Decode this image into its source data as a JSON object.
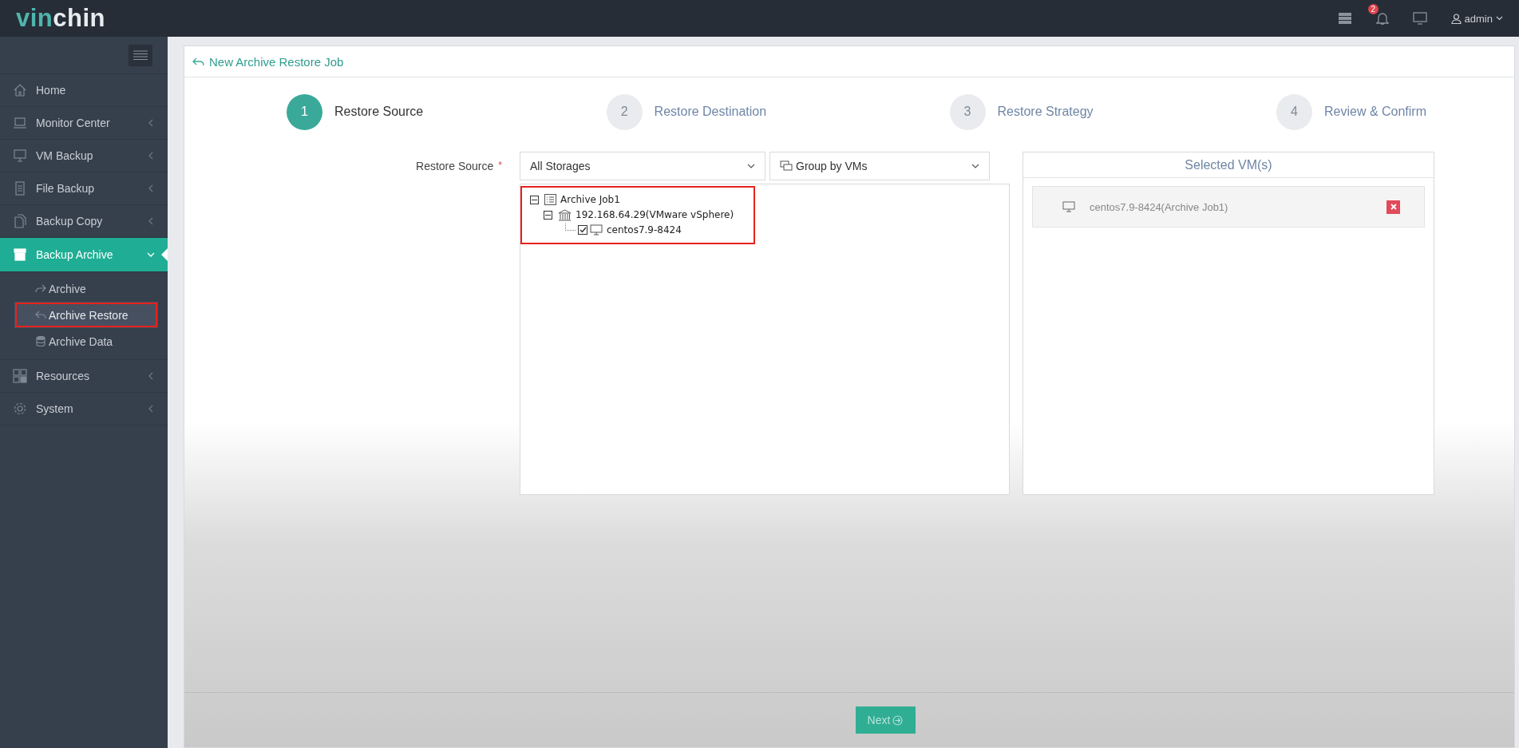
{
  "topbar": {
    "logo": [
      "vin",
      "chin"
    ],
    "notifications": "2",
    "user": "admin"
  },
  "sidebar": {
    "items": [
      {
        "label": "Home",
        "kind": "home",
        "selected": false,
        "expandable": false
      },
      {
        "label": "Monitor Center",
        "kind": "laptop",
        "selected": false,
        "expandable": true,
        "expanded": false
      },
      {
        "label": "VM Backup",
        "kind": "monitor",
        "selected": false,
        "expandable": true,
        "expanded": false
      },
      {
        "label": "File Backup",
        "kind": "file",
        "selected": false,
        "expandable": true,
        "expanded": false
      },
      {
        "label": "Backup Copy",
        "kind": "copy",
        "selected": false,
        "expandable": true,
        "expanded": false
      },
      {
        "label": "Backup Archive",
        "kind": "archive",
        "selected": true,
        "expandable": true,
        "expanded": true,
        "children": [
          {
            "label": "Archive",
            "kind": "forward",
            "selected": false,
            "highlighted": false
          },
          {
            "label": "Archive Restore",
            "kind": "reply",
            "selected": true,
            "highlighted": true
          },
          {
            "label": "Archive Data",
            "kind": "database",
            "selected": false,
            "highlighted": false
          }
        ]
      },
      {
        "label": "Resources",
        "kind": "grid",
        "selected": false,
        "expandable": true,
        "expanded": false
      },
      {
        "label": "System",
        "kind": "gear",
        "selected": false,
        "expandable": true,
        "expanded": false
      }
    ]
  },
  "panel": {
    "title": "New Archive Restore Job"
  },
  "steps": [
    {
      "number": "1",
      "label": "Restore Source",
      "selected": true
    },
    {
      "number": "2",
      "label": "Restore Destination",
      "selected": false
    },
    {
      "number": "3",
      "label": "Restore Strategy",
      "selected": false
    },
    {
      "number": "4",
      "label": "Review & Confirm",
      "selected": false
    }
  ],
  "form": {
    "label": "Restore Source",
    "required_mark": "*",
    "storage": "All Storages",
    "grouping": "Group by VMs"
  },
  "tree": {
    "highlighted": true,
    "nodes": [
      {
        "label": "Archive Job1",
        "kind": "job",
        "expanded": true,
        "children": [
          {
            "label": "192.168.64.29(VMware vSphere)",
            "kind": "host",
            "expanded": true,
            "children": [
              {
                "label": "centos7.9-8424",
                "kind": "vm",
                "checked": true
              }
            ]
          }
        ]
      }
    ]
  },
  "selected_panel": {
    "title": "Selected VM(s)",
    "items": [
      {
        "label": "centos7.9-8424(Archive Job1)"
      }
    ]
  },
  "footer": {
    "next": "Next"
  }
}
